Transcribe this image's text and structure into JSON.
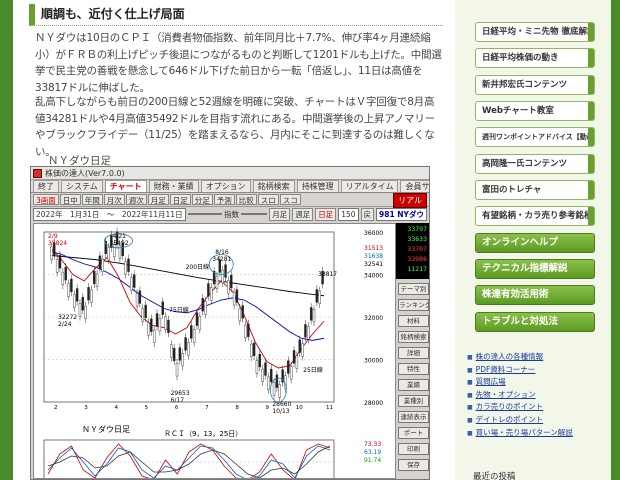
{
  "article": {
    "heading": "順調も、近付く仕上げ局面",
    "para1": "ＮＹダウは10日のＣＰＩ（消費者物価指数、前年同月比＋7.7%、伸び率4ヶ月連続縮小）がＦＲＢの利上げピッチ後退につながるものと判断して1201ドルも上げた。中間選挙で民主党の善戦を懸念して646ドル下げた前日から一転「倍返し」、11日は高値を33817ドルに伸ばした。",
    "para2": "乱高下しながらも前日の200日線と52週線を明確に突破、チャートはＶ字回復で8月高値34281ドルや4月高値35492ドルを目指す流れにある。中間選挙後の上昇アノマリーやブラックフライデー（11/25）を踏まえるなら、月内にそこに到達するのは難しくない。",
    "chart_caption": "ＮＹダウ日足"
  },
  "app": {
    "title": "株価の達人(Ver7.0.0)",
    "tabs": [
      "終了",
      "システム",
      "チャート",
      "財務・業績",
      "オプション",
      "銘柄検索",
      "持株管理",
      "リアルタイム",
      "会員サイト"
    ],
    "toolbar1": [
      "3画面",
      "日中",
      "年間",
      "月次",
      "週次",
      "月足",
      "日足",
      "分足",
      "予測",
      "比較",
      "スロ",
      "スコ"
    ],
    "realtime_button": "リアル",
    "date_range": "2022年　1月31日　〜　2022年11月11日",
    "index_label": "指数",
    "scale_btns": [
      "月足",
      "週足",
      "日足"
    ],
    "scale_value": "150",
    "back_label": "戻",
    "symbol": "981 NYダウ",
    "ticker_values": [
      {
        "v": "33797",
        "c": "#40ff40"
      },
      {
        "v": "33633",
        "c": "#40ff40"
      },
      {
        "v": "33707",
        "c": "#ff4040"
      },
      {
        "v": "32986",
        "c": "#ff4040"
      },
      {
        "v": "11217",
        "c": "#40ff40"
      }
    ],
    "side_buttons": [
      "テーマ別",
      "ランキング",
      "材料",
      "銘柄検索",
      "詳細",
      "特性",
      "業績",
      "業種別",
      "連続表示",
      "ポート",
      "印刷",
      "保存"
    ]
  },
  "chart_data": {
    "type": "line",
    "title": "ＮＹダウ日足",
    "subchart_title": "ＲＣＩ（9，13，25日）",
    "y_labels": [
      "36000",
      "34000",
      "32000",
      "30000",
      "28000"
    ],
    "right_values": [
      {
        "v": "31513",
        "c": "#d00000"
      },
      {
        "v": "31638",
        "c": "#0060d0"
      },
      {
        "v": "32541",
        "c": "#000000"
      }
    ],
    "annotations": [
      {
        "text": "2/9",
        "color": "#d00000"
      },
      {
        "text": "35824",
        "color": "#d00000"
      },
      {
        "text": "4/21",
        "color": "#000000"
      },
      {
        "text": "35492",
        "color": "#000000"
      },
      {
        "text": "8/16",
        "color": "#000000"
      },
      {
        "text": "34281",
        "color": "#000000"
      },
      {
        "text": "33817",
        "color": "#000000"
      },
      {
        "text": "200日線",
        "color": "#000000"
      },
      {
        "text": "75日線",
        "color": "#000000"
      },
      {
        "text": "25日線",
        "color": "#000000"
      },
      {
        "text": "32272",
        "color": "#000000"
      },
      {
        "text": "2/24",
        "color": "#000000"
      },
      {
        "text": "29653",
        "color": "#000000"
      },
      {
        "text": "6/17",
        "color": "#000000"
      },
      {
        "text": "28660",
        "color": "#000000"
      },
      {
        "text": "10/13",
        "color": "#000000"
      }
    ],
    "x_ticks": [
      "2",
      "3",
      "4",
      "5",
      "6",
      "7",
      "8",
      "9",
      "10",
      "11"
    ],
    "series": [
      {
        "name": "200日線",
        "color": "#000000",
        "values": [
          34900,
          34850,
          34800,
          34750,
          34700,
          34620,
          34540,
          34450,
          34350,
          34250,
          34150,
          34050,
          33950,
          33850,
          33760,
          33680,
          33600,
          33520,
          33440,
          33360,
          33280,
          33200,
          33130,
          33060,
          33000
        ]
      },
      {
        "name": "75日線",
        "color": "#0000cc",
        "values": [
          35100,
          34950,
          34700,
          34500,
          34350,
          34100,
          33800,
          33400,
          33000,
          32700,
          32400,
          32250,
          32200,
          32350,
          32600,
          32800,
          32900,
          32800,
          32500,
          32100,
          31700,
          31300,
          31000,
          30900,
          31000
        ]
      },
      {
        "name": "25日線",
        "color": "#d00000",
        "values": [
          35300,
          34700,
          34000,
          33700,
          34300,
          34800,
          33900,
          32700,
          32000,
          31600,
          31500,
          31200,
          31500,
          32400,
          33100,
          33700,
          33200,
          32100,
          30800,
          29900,
          29600,
          29700,
          30500,
          31200,
          31800
        ]
      },
      {
        "name": "価格",
        "color": "#333333",
        "values": [
          35400,
          34200,
          33100,
          32272,
          33800,
          35200,
          35492,
          34000,
          32500,
          31200,
          32300,
          29653,
          30600,
          31800,
          33200,
          34281,
          33300,
          31800,
          30000,
          29200,
          28660,
          29500,
          30500,
          32100,
          33817
        ]
      }
    ],
    "rci_labels": [
      {
        "v": "73.33",
        "c": "#d00000"
      },
      {
        "v": "63.19",
        "c": "#0060d0"
      },
      {
        "v": "91.74",
        "c": "#00a000"
      }
    ],
    "rci_series": [
      {
        "name": "9日",
        "color": "#d00000",
        "values": [
          -60,
          40,
          80,
          -40,
          -80,
          20,
          90,
          30,
          -70,
          -90,
          10,
          -60,
          50,
          90,
          60,
          -20,
          -80,
          -90,
          -50,
          40,
          -40,
          -90,
          60,
          90,
          70
        ]
      },
      {
        "name": "13日",
        "color": "#0060d0",
        "values": [
          -40,
          20,
          70,
          0,
          -70,
          -10,
          70,
          50,
          -40,
          -80,
          -20,
          -40,
          20,
          80,
          70,
          10,
          -60,
          -90,
          -70,
          10,
          -10,
          -80,
          30,
          80,
          60
        ]
      },
      {
        "name": "25日",
        "color": "#333333",
        "values": [
          -20,
          0,
          30,
          20,
          -30,
          -20,
          30,
          50,
          0,
          -50,
          -50,
          -40,
          -10,
          40,
          60,
          40,
          -10,
          -60,
          -80,
          -40,
          -30,
          -60,
          -10,
          50,
          80
        ]
      }
    ]
  },
  "sidebar": {
    "buttons": [
      "日経平均・ミニ先物 徹底解説",
      "日経平均株価の動き",
      "新井邦宏氏コンテンツ",
      "Webチャート教室",
      "週刊ワンポイントアドバイス【動画】",
      "高岡隆一氏コンテンツ",
      "富田のトレチャ",
      "有望銘柄・カラ売り参考銘柄"
    ],
    "green_buttons": [
      "オンラインヘルプ",
      "テクニカル指標解説",
      "株達有効活用術",
      "トラブルと対処法"
    ],
    "links": [
      "株の達人の各種情報",
      "PDF資料コーナー",
      "質問広場",
      "先物・オプション",
      "カラ売りのポイント",
      "デイトレのポイント",
      "買い場・売り場パターン解説"
    ],
    "recent_label": "最近の投稿"
  }
}
